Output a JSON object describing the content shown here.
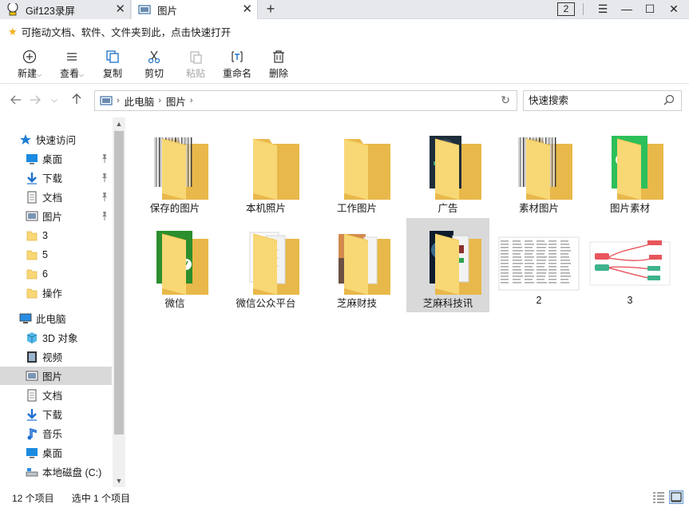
{
  "tabs": [
    {
      "title": "Gif123录屏",
      "icon": "gif-recorder-icon"
    },
    {
      "title": "图片",
      "icon": "pictures-folder-icon"
    }
  ],
  "tab_count": "2",
  "hint": "可拖动文档、软件、文件夹到此，点击快速打开",
  "ribbon": {
    "new": "新建",
    "view": "查看",
    "copy": "复制",
    "cut": "剪切",
    "paste": "粘贴",
    "rename": "重命名",
    "delete": "删除"
  },
  "address": {
    "crumbs": [
      "此电脑",
      "图片"
    ]
  },
  "search": {
    "placeholder": "快速搜索"
  },
  "sidebar": {
    "items": [
      {
        "label": "快速访问",
        "icon": "star-icon"
      },
      {
        "label": "桌面",
        "icon": "desktop-icon",
        "pinned": true
      },
      {
        "label": "下载",
        "icon": "download-icon",
        "pinned": true
      },
      {
        "label": "文档",
        "icon": "document-icon",
        "pinned": true
      },
      {
        "label": "图片",
        "icon": "pictures-icon",
        "pinned": true
      },
      {
        "label": "3",
        "icon": "folder-icon"
      },
      {
        "label": "5",
        "icon": "folder-icon"
      },
      {
        "label": "6",
        "icon": "folder-icon"
      },
      {
        "label": "操作",
        "icon": "folder-icon"
      },
      {
        "label": "此电脑",
        "icon": "computer-icon"
      },
      {
        "label": "3D 对象",
        "icon": "3d-objects-icon"
      },
      {
        "label": "视频",
        "icon": "video-icon"
      },
      {
        "label": "图片",
        "icon": "pictures-icon",
        "selected": true
      },
      {
        "label": "文档",
        "icon": "document-icon"
      },
      {
        "label": "下载",
        "icon": "download-icon"
      },
      {
        "label": "音乐",
        "icon": "music-icon"
      },
      {
        "label": "桌面",
        "icon": "desktop-icon"
      },
      {
        "label": "本地磁盘 (C:)",
        "icon": "drive-icon"
      }
    ]
  },
  "files": [
    {
      "name": "保存的图片",
      "type": "folder",
      "preview": "documents"
    },
    {
      "name": "本机照片",
      "type": "folder",
      "preview": "none"
    },
    {
      "name": "工作图片",
      "type": "folder",
      "preview": "none"
    },
    {
      "name": "广告",
      "type": "folder",
      "preview": "night"
    },
    {
      "name": "素材图片",
      "type": "folder",
      "preview": "documents"
    },
    {
      "name": "图片素材",
      "type": "folder",
      "preview": "wechat"
    },
    {
      "name": "微信",
      "type": "folder",
      "preview": "wechat-dark"
    },
    {
      "name": "微信公众平台",
      "type": "folder",
      "preview": "paper"
    },
    {
      "name": "芝麻财技",
      "type": "folder",
      "preview": "sunset"
    },
    {
      "name": "芝麻科技讯",
      "type": "folder",
      "preview": "space",
      "selected": true
    },
    {
      "name": "2",
      "type": "image",
      "preview": "table"
    },
    {
      "name": "3",
      "type": "image",
      "preview": "mindmap"
    }
  ],
  "status": {
    "count": "12 个项目",
    "selected": "选中 1 个项目"
  },
  "colors": {
    "folder": "#f8d775",
    "folder_dark": "#e8b84a",
    "selection": "#d9d9d9",
    "wechat_green": "#2dc100"
  }
}
